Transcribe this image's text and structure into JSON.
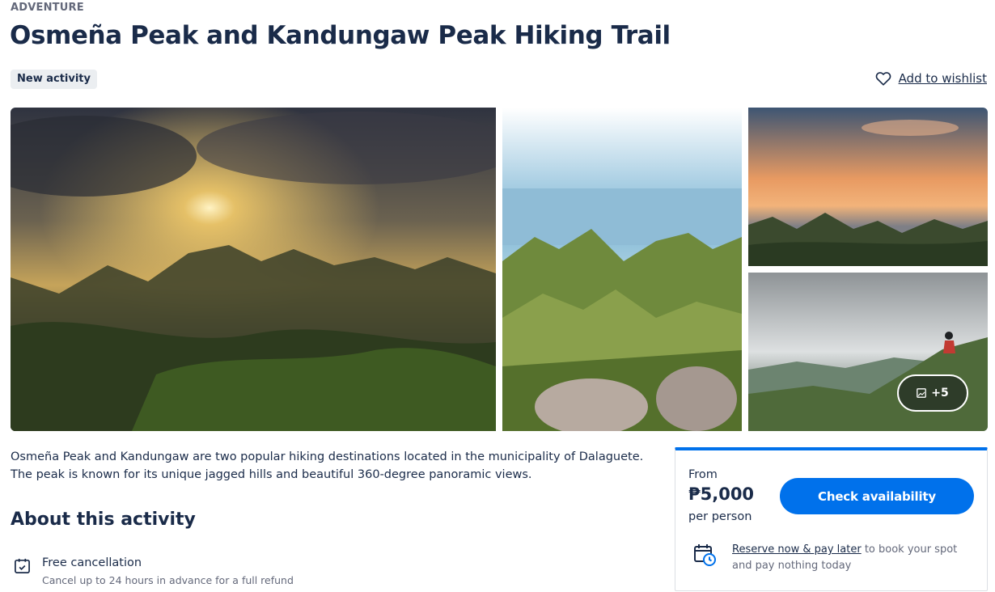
{
  "header": {
    "category": "ADVENTURE",
    "title": "Osmeña Peak and Kandungaw Peak Hiking Trail",
    "badge": "New activity",
    "wishlist_label": "Add to wishlist"
  },
  "gallery": {
    "more_label": "+5",
    "more_icon": "image-icon"
  },
  "description": "Osmeña Peak and Kandungaw are two popular hiking destinations located in the municipality of Dalaguete. The peak is known for its unique jagged hills and beautiful 360-degree panoramic views.",
  "about": {
    "heading": "About this activity",
    "features": [
      {
        "icon": "calendar-check-icon",
        "title": "Free cancellation",
        "subtitle": "Cancel up to 24 hours in advance for a full refund"
      }
    ]
  },
  "booking": {
    "from_label": "From",
    "price": "₱5,000",
    "per_label": "per person",
    "cta_label": "Check availability",
    "reserve_link": "Reserve now & pay later",
    "reserve_text": " to book your spot and pay nothing today",
    "reserve_icon": "calendar-clock-icon"
  },
  "colors": {
    "primary": "#0071eb",
    "text": "#1a2b49",
    "muted": "#63687a",
    "badge_bg": "#ebeef1"
  }
}
